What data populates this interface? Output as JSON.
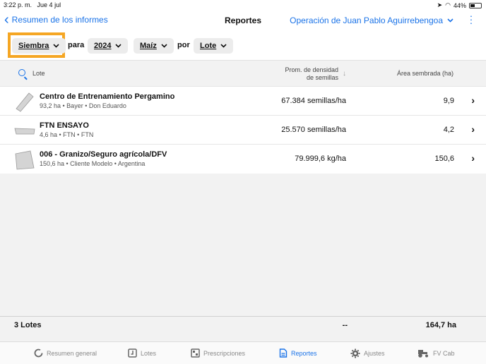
{
  "status_bar": {
    "time": "3:22 p. m.",
    "date": "Jue 4 jul",
    "battery": "44%"
  },
  "nav": {
    "back_label": "Resumen de los informes",
    "title": "Reportes",
    "operation": "Operación de Juan Pablo Aguirrebengoa"
  },
  "filters": {
    "type_value": "Siembra",
    "connector_for": "para",
    "year_value": "2024",
    "crop_value": "Maíz",
    "connector_by": "por",
    "group_value": "Lote"
  },
  "table": {
    "search_label": "Lote",
    "col_density_line1": "Prom. de densidad",
    "col_density_line2": "de semillas",
    "col_area": "Área sembrada (ha)",
    "rows": [
      {
        "name": "Centro de Entrenamiento Pergamino",
        "sub": "93,2 ha • Bayer • Don Eduardo",
        "value": "67.384 semillas/ha",
        "area": "9,9"
      },
      {
        "name": "FTN ENSAYO",
        "sub": "4,6 ha • FTN • FTN",
        "value": "25.570 semillas/ha",
        "area": "4,2"
      },
      {
        "name": "006 - Granizo/Seguro agrícola/DFV",
        "sub": "150,6 ha • Cliente Modelo • Argentina",
        "value": "79.999,6 kg/ha",
        "area": "150,6"
      }
    ]
  },
  "totals": {
    "label": "3 Lotes",
    "density": "--",
    "area": "164,7 ha"
  },
  "tabs": [
    {
      "label": "Resumen general",
      "icon": "summary-icon"
    },
    {
      "label": "Lotes",
      "icon": "fields-icon"
    },
    {
      "label": "Prescripciones",
      "icon": "prescriptions-icon"
    },
    {
      "label": "Reportes",
      "icon": "reports-icon",
      "active": true
    },
    {
      "label": "Ajustes",
      "icon": "gear-icon"
    },
    {
      "label": "FV Cab",
      "icon": "tractor-icon"
    }
  ],
  "colors": {
    "accent": "#1a73e8",
    "highlight": "#f5a623"
  }
}
